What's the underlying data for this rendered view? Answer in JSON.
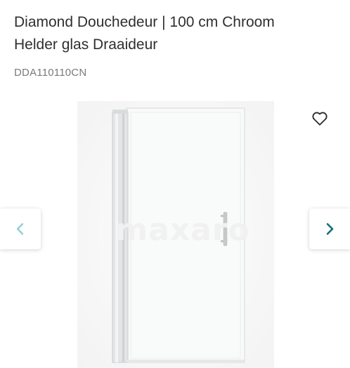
{
  "product": {
    "title_line1": "Diamond Douchedeur | 100 cm Chroom",
    "title_line2": "Helder glas Draaideur",
    "sku": "DDA110110CN"
  },
  "gallery": {
    "watermark": "maxaro",
    "prev_icon": "chevron-left-icon",
    "next_icon": "chevron-right-icon",
    "favorite_icon": "heart-icon"
  },
  "colors": {
    "accent": "#1a9aa8",
    "accent_dark": "#0e6f7a",
    "text": "#2f2f2f",
    "muted": "#7a7a7a"
  }
}
